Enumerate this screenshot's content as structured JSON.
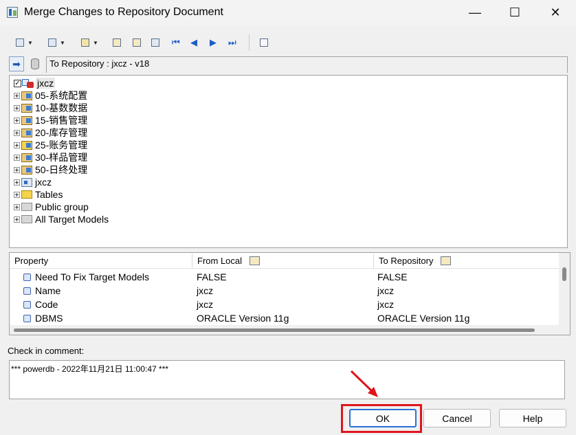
{
  "window": {
    "title": "Merge Changes to Repository Document",
    "minimize": "—",
    "maximize": "☐",
    "close": "✕"
  },
  "toolbar": {
    "nav_first": "⏮",
    "nav_prev": "◀",
    "nav_next": "▶",
    "nav_last": "⏭"
  },
  "path": {
    "label": "To Repository : jxcz - v18"
  },
  "tree": {
    "root": "jxcz",
    "items": [
      {
        "label": "05-系统配置",
        "icon": "package-icon"
      },
      {
        "label": "10-基数数据",
        "icon": "package-icon"
      },
      {
        "label": "15-销售管理",
        "icon": "package-icon"
      },
      {
        "label": "20-库存管理",
        "icon": "package-icon"
      },
      {
        "label": "25-账务管理",
        "icon": "package-icon"
      },
      {
        "label": "30-样品管理",
        "icon": "package-icon"
      },
      {
        "label": "50-日终处理",
        "icon": "package-icon"
      },
      {
        "label": "jxcz",
        "icon": "model-icon"
      },
      {
        "label": "Tables",
        "icon": "warning-folder-icon"
      },
      {
        "label": "Public group",
        "icon": "folder-icon"
      },
      {
        "label": "All Target Models",
        "icon": "folder-icon"
      }
    ]
  },
  "properties": {
    "headers": [
      "Property",
      "From Local",
      "To Repository"
    ],
    "rows": [
      {
        "property": "Need To Fix Target Models",
        "from_local": "FALSE",
        "to_repository": "FALSE"
      },
      {
        "property": "Name",
        "from_local": "jxcz",
        "to_repository": "jxcz"
      },
      {
        "property": "Code",
        "from_local": "jxcz",
        "to_repository": "jxcz"
      },
      {
        "property": "DBMS",
        "from_local": "ORACLE Version 11g",
        "to_repository": "ORACLE Version 11g"
      }
    ]
  },
  "comment": {
    "label": "Check in comment:",
    "value": "*** powerdb - 2022年11月21日  11:00:47 ***"
  },
  "buttons": {
    "ok": "OK",
    "cancel": "Cancel",
    "help": "Help"
  },
  "colors": {
    "highlight": "#e0141c",
    "accent": "#2a6fd6"
  }
}
